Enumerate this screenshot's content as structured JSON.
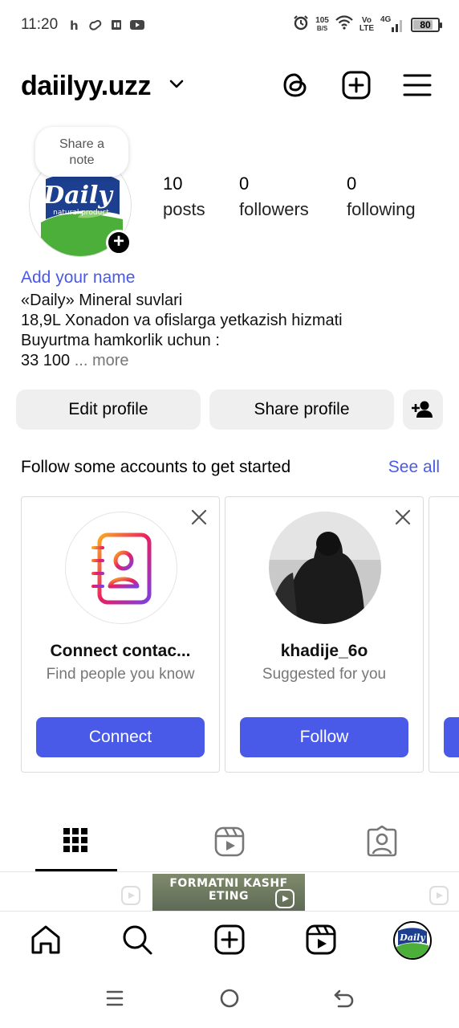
{
  "status": {
    "time": "11:20",
    "net_speed_value": "105",
    "net_speed_unit": "B/S",
    "volte_top": "Vo",
    "volte_bottom": "LTE",
    "network": "4G",
    "battery": "80",
    "battery_level_pct": 80
  },
  "header": {
    "username": "daiilyy.uzz"
  },
  "profile": {
    "note_line1": "Share a",
    "note_line2": "note",
    "logo_text": "Daily",
    "logo_sub": "natural product",
    "stats": [
      {
        "value": "10",
        "label": "posts"
      },
      {
        "value": "0",
        "label": "followers"
      },
      {
        "value": "0",
        "label": "following"
      }
    ],
    "add_name": "Add your name",
    "bio_lines": [
      "«Daily» Mineral suvlari",
      "18,9L Xonadon va ofislarga yetkazish hizmati",
      "Buyurtma hamkorlik uchun :"
    ],
    "bio_last": "33 100",
    "bio_more": "... more",
    "edit_profile": "Edit profile",
    "share_profile": "Share profile"
  },
  "suggestions": {
    "title": "Follow some accounts to get started",
    "see_all": "See all",
    "cards": [
      {
        "title": "Connect contac...",
        "subtitle": "Find people you know",
        "button": "Connect"
      },
      {
        "title": "khadije_6o",
        "subtitle": "Suggested for you",
        "button": "Follow"
      }
    ]
  },
  "grid": {
    "thumb_text": "FORMATNI KASHF ETING"
  },
  "colors": {
    "accent": "#4a5ae8",
    "button_bg": "#efefef",
    "logo_blue": "#1c3f8f",
    "logo_green": "#4caf3a"
  },
  "icons": {
    "header": [
      "threads-icon",
      "create-post-icon",
      "menu-icon"
    ],
    "tabs": [
      "grid-icon",
      "reels-icon",
      "tagged-icon"
    ],
    "bottom_nav": [
      "home-icon",
      "search-icon",
      "create-icon",
      "reels-icon",
      "profile-avatar"
    ]
  }
}
